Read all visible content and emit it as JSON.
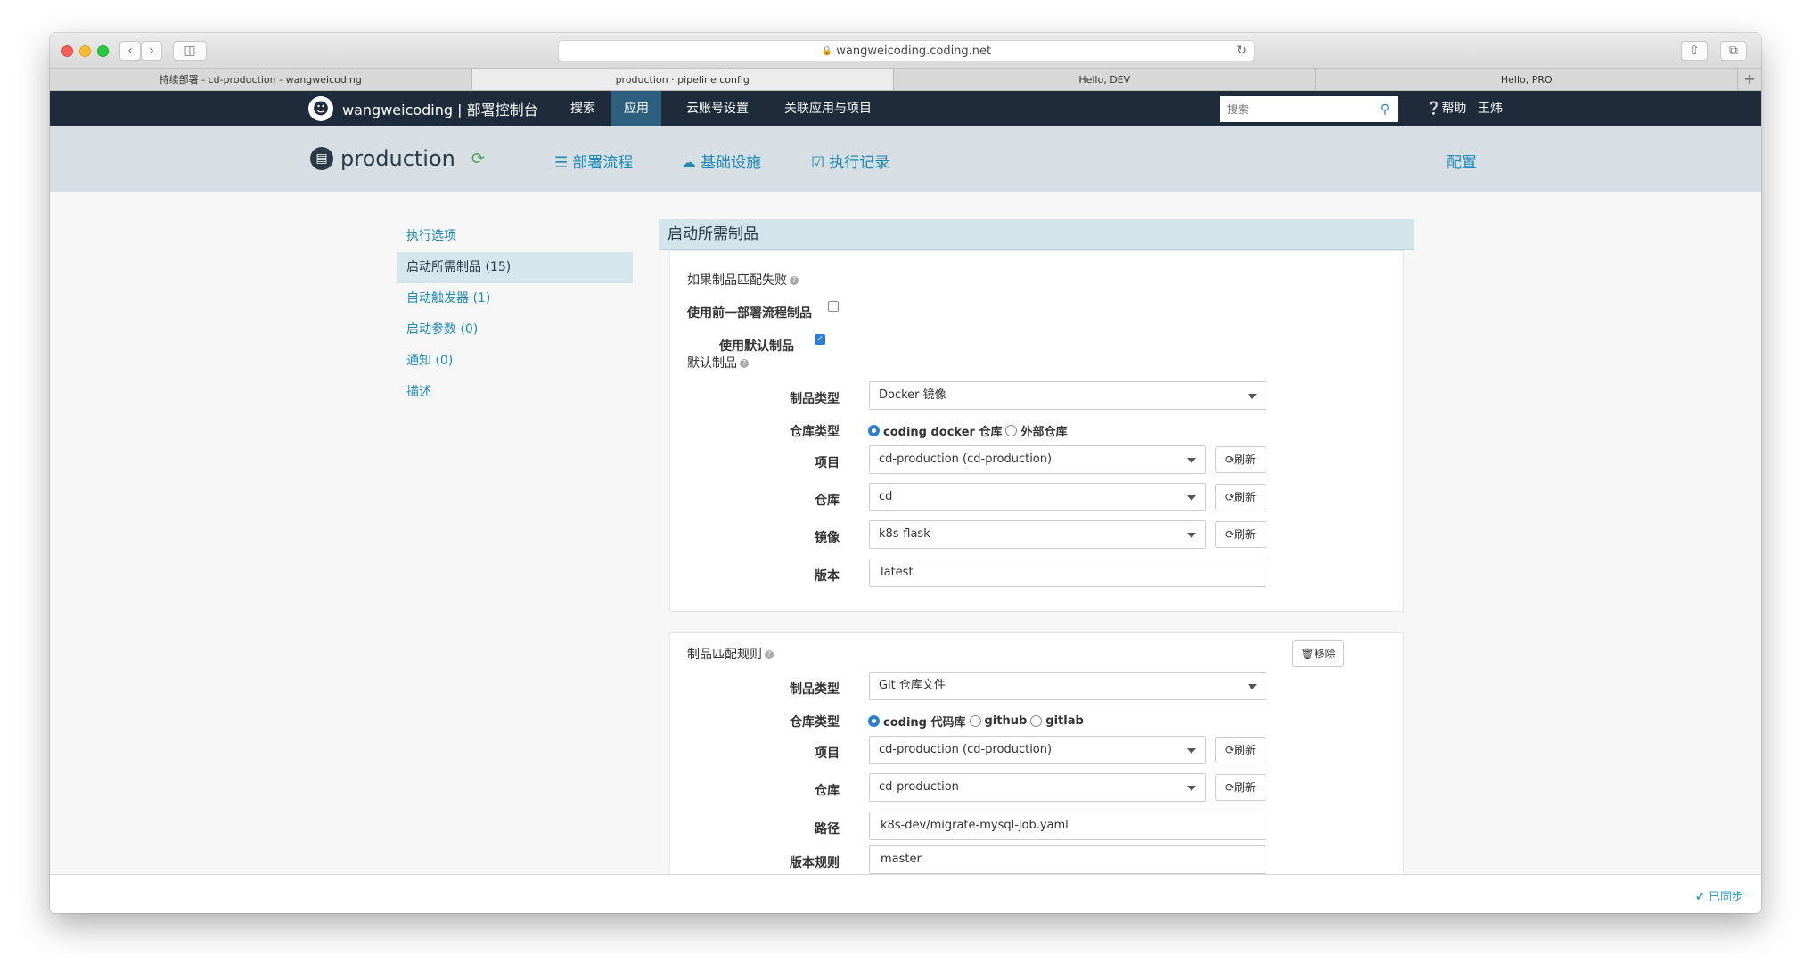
{
  "browser": {
    "url": "wangweicoding.coding.net",
    "tabs": [
      "持续部署 - cd-production - wangweicoding",
      "production · pipeline config",
      "Hello, DEV",
      "Hello, PRO"
    ],
    "active_tab": 1
  },
  "topnav": {
    "brand": "wangweicoding | 部署控制台",
    "items": [
      "搜索",
      "应用",
      "云账号设置",
      "关联应用与项目"
    ],
    "active_item": 1,
    "search_placeholder": "搜索",
    "help": "帮助",
    "user": "王炜"
  },
  "subheader": {
    "pipeline_name": "production",
    "tabs": [
      "部署流程",
      "基础设施",
      "执行记录"
    ],
    "config": "配置"
  },
  "leftnav": {
    "items": [
      "执行选项",
      "启动所需制品 (15)",
      "自动触发器 (1)",
      "启动参数 (0)",
      "通知 (0)",
      "描述"
    ],
    "active": 1
  },
  "section": {
    "title": "启动所需制品",
    "card1": {
      "fail_label": "如果制品匹配失败",
      "use_prev_label": "使用前一部署流程制品",
      "use_prev_checked": false,
      "use_default_label": "使用默认制品",
      "use_default_checked": true,
      "default_label": "默认制品",
      "type_label": "制品类型",
      "type_value": "Docker 镜像",
      "repo_type_label": "仓库类型",
      "repo_type_options": [
        "coding docker 仓库",
        "外部仓库"
      ],
      "repo_type_selected": 0,
      "project_label": "项目",
      "project_value": "cd-production (cd-production)",
      "repo_label": "仓库",
      "repo_value": "cd",
      "image_label": "镜像",
      "image_value": "k8s-flask",
      "version_label": "版本",
      "version_value": "latest",
      "refresh": "刷新"
    },
    "card2": {
      "rule_label": "制品匹配规则",
      "remove": "移除",
      "type_label": "制品类型",
      "type_value": "Git 仓库文件",
      "repo_type_label": "仓库类型",
      "repo_type_options": [
        "coding 代码库",
        "github",
        "gitlab"
      ],
      "repo_type_selected": 0,
      "project_label": "项目",
      "project_value": "cd-production (cd-production)",
      "repo_label": "仓库",
      "repo_value": "cd-production",
      "path_label": "路径",
      "path_value": "k8s-dev/migrate-mysql-job.yaml",
      "version_rule_label": "版本规则",
      "version_rule_value": "master",
      "refresh": "刷新"
    }
  },
  "status": {
    "synced": "已同步"
  },
  "colors": {
    "nav_bg": "#1d2b3a",
    "accent": "#1a8bb4",
    "subheader_bg": "#d7dfe5",
    "section_head_bg": "#d1e5ea"
  }
}
